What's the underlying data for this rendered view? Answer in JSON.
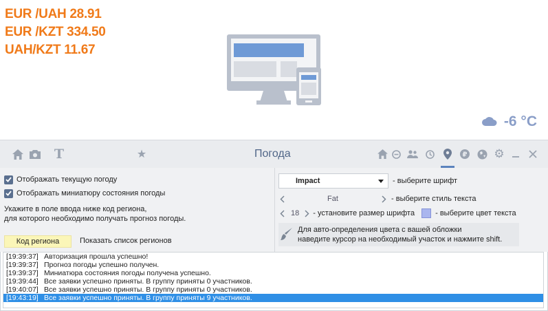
{
  "rates": [
    "EUR /UAH 28.91",
    "EUR /KZT 334.50",
    "UAH/KZT 11.67"
  ],
  "weather": {
    "icon": "cloud-icon",
    "temperature": "-6 °C"
  },
  "toolbar": {
    "title": "Погода",
    "left_icons": [
      "home-icon",
      "camera-icon",
      "text-icon",
      "star-icon"
    ],
    "right_icons": [
      "home-icon",
      "minus-circle-icon",
      "users-icon",
      "clock-icon",
      "location-pin-icon",
      "ruble-icon",
      "globe-icon",
      "gear-icon",
      "minimize-icon",
      "close-icon"
    ],
    "active_icon": "location-pin-icon"
  },
  "options": {
    "show_current_weather": "Отображать текущую погоду",
    "show_weather_thumbnail": "Отображать миниатюру состояния погоды",
    "region_hint_line1": "Укажите в поле ввода ниже код региона,",
    "region_hint_line2": "для которого необходимо получать прогноз погоды.",
    "region_code_tab": "Код региона",
    "show_regions_link": "Показать список регионов"
  },
  "font": {
    "selected": "Impact",
    "select_label": "- выберите шрифт",
    "style": "Fat",
    "style_label": "- выберите стиль текста",
    "size": "18",
    "size_label": "- установите размер шрифта",
    "color_label": "- выберите цвет текста",
    "color": "#aab6ee"
  },
  "autocolor": {
    "line1": "Для авто-определения цвета с вашей обложки",
    "line2": "наведите курсор на необходимый участок и нажмите shift."
  },
  "log": [
    {
      "time": "[19:39:37]",
      "text": "Авторизация прошла успешно!"
    },
    {
      "time": "[19:39:37]",
      "text": "Прогноз погоды успешно получен."
    },
    {
      "time": "[19:39:37]",
      "text": "Миниатюра состояния погоды получена успешно."
    },
    {
      "time": "[19:39:44]",
      "text": "Все заявки успешно приняты. В группу приняты 0 участников."
    },
    {
      "time": "[19:40:07]",
      "text": "Все заявки успешно приняты. В группу приняты 0 участников."
    },
    {
      "time": "[19:43:19]",
      "text": "Все заявки успешно приняты. В группу приняты 9 участников.",
      "selected": true
    }
  ],
  "colors": {
    "accent": "#f07a19",
    "toolbar_title": "#4f6587",
    "selection": "#2f8fe6",
    "weather": "#8a9ec8",
    "region_tab": "#fbf6b8"
  }
}
